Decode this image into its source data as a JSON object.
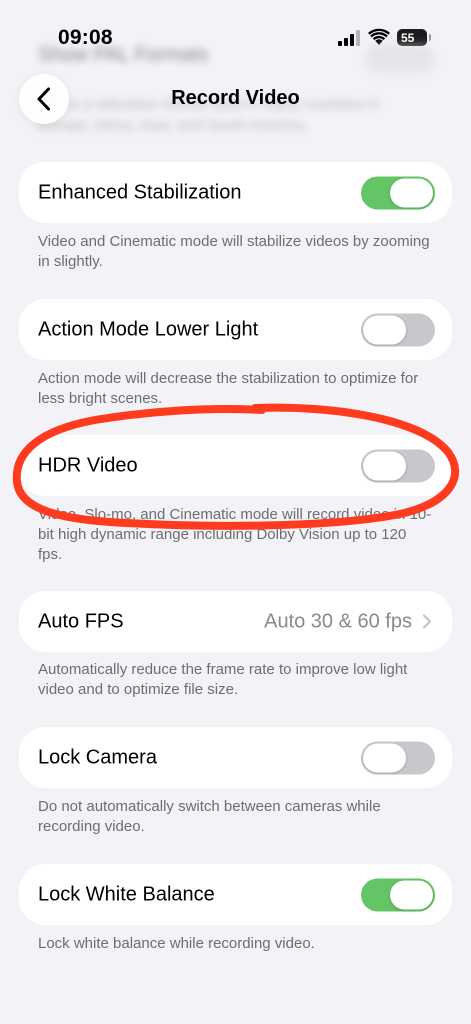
{
  "status_bar": {
    "time": "09:08",
    "battery": "55"
  },
  "background": {
    "row_label": "Show PAL Formats",
    "description": "PAL is a television format used in many countries in Europe, Africa, Asia, and South America."
  },
  "nav": {
    "title": "Record Video"
  },
  "settings": [
    {
      "label": "Enhanced Stabilization",
      "type": "toggle",
      "on": true,
      "description": "Video and Cinematic mode will stabilize videos by zooming in slightly."
    },
    {
      "label": "Action Mode Lower Light",
      "type": "toggle",
      "on": false,
      "description": "Action mode will decrease the stabilization to optimize for less bright scenes."
    },
    {
      "label": "HDR Video",
      "type": "toggle",
      "on": false,
      "description": "Video, Slo-mo, and Cinematic mode will record video in 10-bit high dynamic range including Dolby Vision up to 120 fps."
    },
    {
      "label": "Auto FPS",
      "type": "link",
      "value": "Auto 30 & 60 fps",
      "description": "Automatically reduce the frame rate to improve low light video and to optimize file size."
    },
    {
      "label": "Lock Camera",
      "type": "toggle",
      "on": false,
      "description": "Do not automatically switch between cameras while recording video."
    },
    {
      "label": "Lock White Balance",
      "type": "toggle",
      "on": true,
      "description": "Lock white balance while recording video."
    }
  ],
  "colors": {
    "toggle_on": "#65c466",
    "toggle_off": "#c7c7cc",
    "annotation": "#ff3b1f",
    "background": "#f2f2f7"
  },
  "annotation": {
    "shape": "hand-drawn ellipse",
    "target": "HDR Video"
  }
}
